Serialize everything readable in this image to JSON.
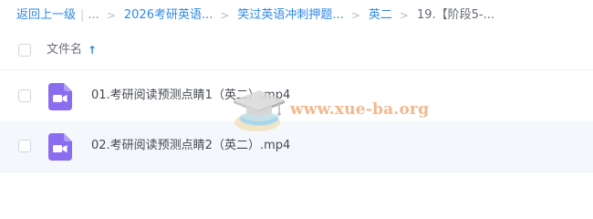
{
  "breadcrumb": {
    "back_label": "返回上一级",
    "separator": "|",
    "ellipsis": "...",
    "arrow": ">",
    "items": [
      {
        "label": "2026考研英语..."
      },
      {
        "label": "笑过英语冲刺押题..."
      },
      {
        "label": "英二"
      }
    ],
    "current": "19.【阶段5-..."
  },
  "file_list": {
    "header": {
      "name_label": "文件名",
      "sort_icon": "↑"
    },
    "files": [
      {
        "name": "01.考研阅读预测点睛1（英二）.mp4",
        "icon": "video-file-icon"
      },
      {
        "name": "02.考研阅读预测点睛2（英二）.mp4",
        "icon": "video-file-icon"
      }
    ]
  },
  "watermark": {
    "text": "www.xue-ba.org"
  },
  "colors": {
    "link": "#2f88e8",
    "video_icon": "#8a6cf0",
    "row_highlight": "#f4f8fd",
    "watermark": "#eea878"
  }
}
